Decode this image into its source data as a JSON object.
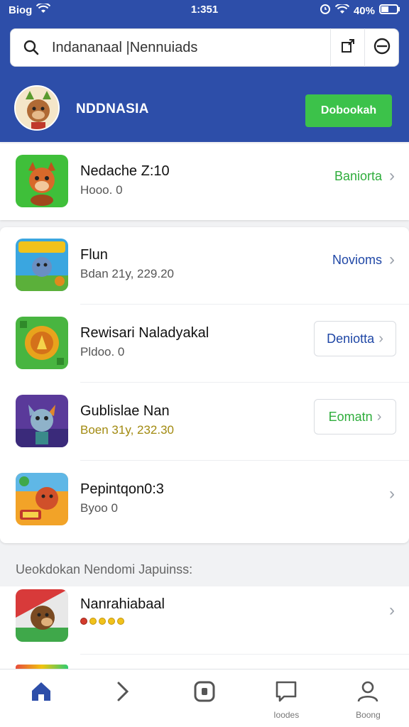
{
  "status_bar": {
    "carrier": "Biog",
    "time": "1:351",
    "battery": "40%"
  },
  "search": {
    "query": "Indananaal |Nennuiads"
  },
  "account": {
    "name": "NDDNASIA",
    "button_label": "Dobookah"
  },
  "featured": {
    "title": "Nedache Z:10",
    "subtitle": "Hooo. 0",
    "action_label": "Baniorta"
  },
  "apps": [
    {
      "title": "Flun",
      "subtitle": "Bdan 21y, 229.20",
      "action_label": "Novioms",
      "action_style": "text"
    },
    {
      "title": "Rewisari Naladyakal",
      "subtitle": "Pldoo. 0",
      "action_label": "Deniotta",
      "action_style": "pill"
    },
    {
      "title": "Gublislae Nan",
      "subtitle": "Boen 31y, 232.30",
      "action_label": "Eomatn",
      "action_style": "pill"
    },
    {
      "title": "Pepintqon0:3",
      "subtitle": "Byoo 0",
      "action_label": "",
      "action_style": "chevron"
    }
  ],
  "recommendations": {
    "section_label": "Ueokdokan Nendomi Japuinss:",
    "items": [
      {
        "title": "Nanrahiabaal",
        "rating": 5
      }
    ]
  },
  "bottom_nav": [
    {
      "icon": "home-icon",
      "label": ""
    },
    {
      "icon": "chevron-right-icon",
      "label": ""
    },
    {
      "icon": "media-icon",
      "label": ""
    },
    {
      "icon": "chat-icon",
      "label": "Ioodes"
    },
    {
      "icon": "profile-icon",
      "label": "Boong"
    }
  ],
  "colors": {
    "header": "#2d4ea9",
    "accent_green": "#3cc24a",
    "link_blue": "#1f47a6"
  }
}
